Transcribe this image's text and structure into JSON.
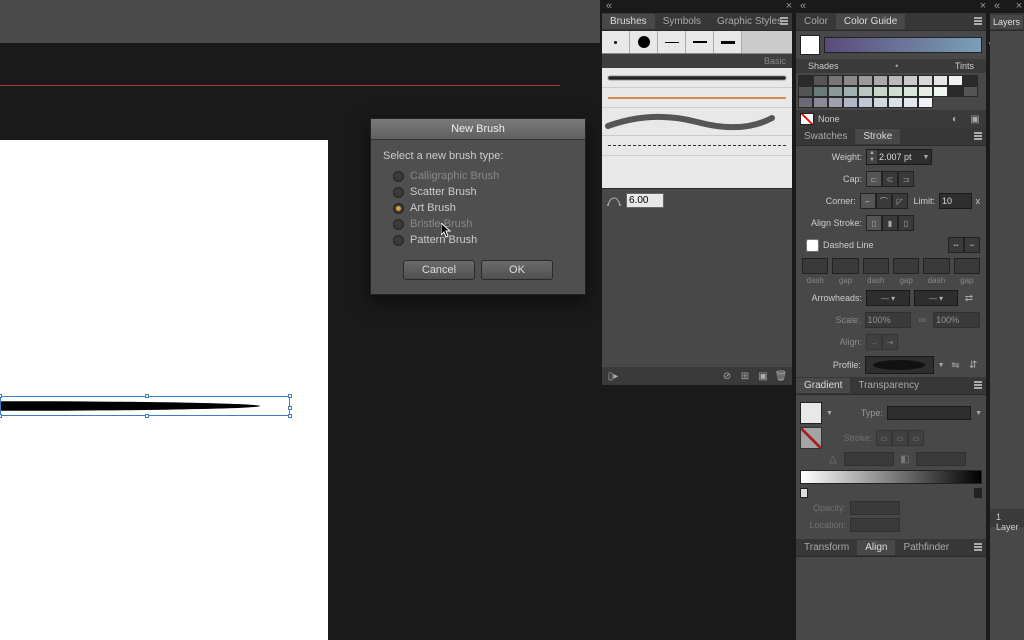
{
  "dialog": {
    "title": "New Brush",
    "prompt": "Select a new brush type:",
    "options": {
      "calligraphic": "Calligraphic Brush",
      "scatter": "Scatter Brush",
      "art": "Art Brush",
      "bristle": "Bristle Brush",
      "pattern": "Pattern Brush"
    },
    "selected": "art",
    "cancel": "Cancel",
    "ok": "OK"
  },
  "panels": {
    "brushes": {
      "tabs": {
        "brushes": "Brushes",
        "symbols": "Symbols",
        "graphic_styles": "Graphic Styles"
      },
      "basic_header": "Basic",
      "stroke_size": "6.00"
    },
    "color": {
      "tabs": {
        "color": "Color",
        "color_guide": "Color Guide"
      },
      "shades": "Shades",
      "tints": "Tints",
      "none": "None",
      "swatch_colors": [
        "#2a2a2a",
        "#555555",
        "#777777",
        "#8a8a8a",
        "#9a9a9a",
        "#aaaaaa",
        "#bababa",
        "#cacaca",
        "#d8d8d8",
        "#e6e6e6",
        "#f2f2f2",
        "#2a2a2a",
        "#555555",
        "#6a7a7a",
        "#8a9a9a",
        "#a0b0b0",
        "#b8c8c0",
        "#c8d8c8",
        "#d0e0d0",
        "#d8e8d8",
        "#e4eee4",
        "#f0f6f0",
        "#2a2a2a",
        "#555555",
        "#6a6a7a",
        "#8a8a9a",
        "#a0a0b0",
        "#b0b8c8",
        "#c0c8d8",
        "#d0d8e0",
        "#d8e0e8",
        "#e4e8ee",
        "#f0f2f6"
      ]
    },
    "stroke": {
      "tabs": {
        "swatches": "Swatches",
        "stroke": "Stroke"
      },
      "labels": {
        "weight": "Weight:",
        "cap": "Cap:",
        "corner": "Corner:",
        "limit": "Limit:",
        "align_stroke": "Align Stroke:",
        "dashed": "Dashed Line",
        "dash": "dash",
        "gap": "gap",
        "arrowheads": "Arrowheads:",
        "scale": "Scale:",
        "align": "Align:",
        "profile": "Profile:"
      },
      "weight_value": "2.007 pt",
      "limit_value": "10",
      "limit_suffix": "x",
      "scale_value": "100%"
    },
    "gradient": {
      "tabs": {
        "gradient": "Gradient",
        "transparency": "Transparency"
      },
      "labels": {
        "type": "Type:",
        "stroke": "Stroke:",
        "angle": "",
        "opacity": "Opacity:",
        "location": "Location:"
      }
    },
    "bottom": {
      "tabs": {
        "transform": "Transform",
        "align": "Align",
        "pathfinder": "Pathfinder"
      }
    },
    "layers": {
      "tab": "Layers",
      "footer": "1 Layer"
    }
  }
}
